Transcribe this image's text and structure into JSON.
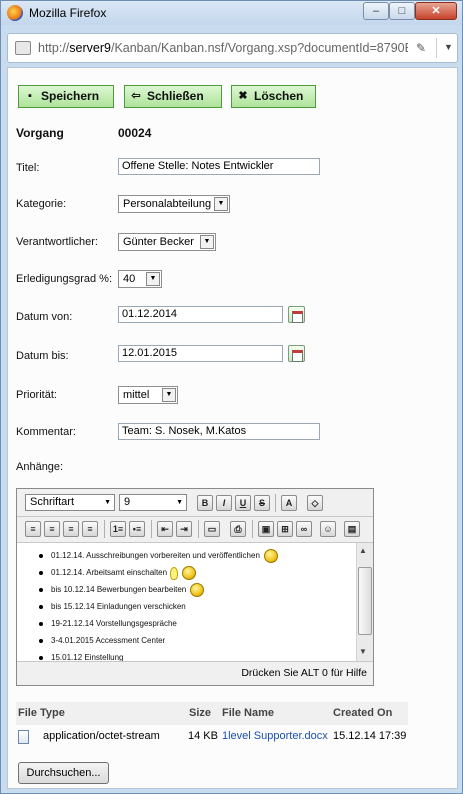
{
  "window": {
    "title": "Mozilla Firefox",
    "minimize": "–",
    "maximize": "□",
    "close": "✕"
  },
  "address": {
    "prefix": "http://",
    "host": "server9",
    "path": "/Kanban/Kanban.nsf/Vorgang.xsp?documentId=8790E"
  },
  "toolbar": {
    "save_label": "Speichern",
    "close_label": "Schließen",
    "delete_label": "Löschen"
  },
  "form": {
    "vorgang_label": "Vorgang",
    "vorgang_value": "00024",
    "titel_label": "Titel:",
    "titel_value": "Offene Stelle:  Notes Entwickler",
    "kategorie_label": "Kategorie:",
    "kategorie_value": "Personalabteilung",
    "verantwortlicher_label": "Verantwortlicher:",
    "verantwortlicher_value": "Günter Becker",
    "erledigungsgrad_label": "Erledigungsgrad %:",
    "erledigungsgrad_value": "40",
    "datum_von_label": "Datum von:",
    "datum_von_value": "01.12.2014",
    "datum_bis_label": "Datum bis:",
    "datum_bis_value": "12.01.2015",
    "prioritaet_label": "Priorität:",
    "prioritaet_value": "mittel",
    "kommentar_label": "Kommentar:",
    "kommentar_value": "Team: S. Nosek, M.Katos",
    "anhaenge_label": "Anhänge:"
  },
  "editor": {
    "font_family": "Schriftart",
    "font_size": "9",
    "items": [
      "01.12.14.  Ausschreibungen vorbereiten und veröffentlichen",
      "01.12.14.  Arbeitsamt einschalten",
      "bis 10.12.14 Bewerbungen bearbeiten",
      "bis 15.12.14 Einladungen verschicken",
      "19-21.12.14 Vorstellungsgespräche",
      "3-4.01.2015 Accessment Center",
      "15.01.12 Einstellung"
    ],
    "status": "Drücken Sie ALT 0 für Hilfe"
  },
  "attachments": {
    "headers": [
      "File Type",
      "Size",
      "File Name",
      "Created On"
    ],
    "rows": [
      {
        "type": "application/octet-stream",
        "size": "14 KB",
        "name": "1level Supporter.docx",
        "created": "15.12.14 17:39"
      }
    ],
    "browse_label": "Durchsuchen..."
  }
}
